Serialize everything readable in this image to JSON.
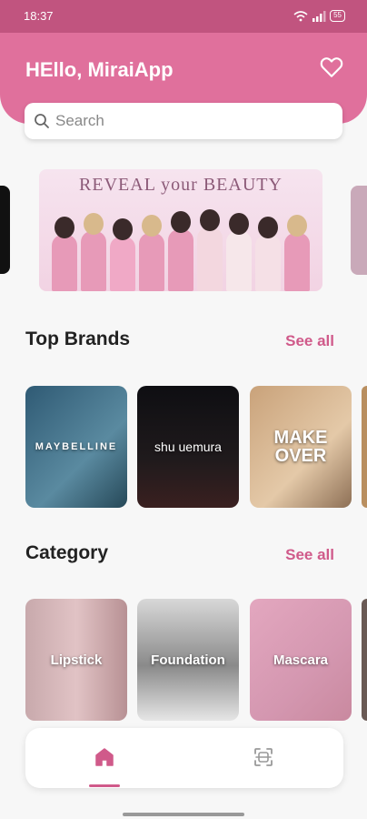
{
  "status_bar": {
    "time": "18:37",
    "battery": "55"
  },
  "header": {
    "greeting": "HEllo, MiraiApp"
  },
  "search": {
    "placeholder": "Search"
  },
  "banner": {
    "title": "REVEAL your BEAUTY"
  },
  "top_brands": {
    "title": "Top Brands",
    "see_all": "See all",
    "items": [
      {
        "label": "MAYBELLINE"
      },
      {
        "label": "shu uemura"
      },
      {
        "label": "MAKE OVER"
      }
    ]
  },
  "category": {
    "title": "Category",
    "see_all": "See all",
    "items": [
      {
        "label": "Lipstick"
      },
      {
        "label": "Foundation"
      },
      {
        "label": "Mascara"
      }
    ]
  },
  "colors": {
    "primary": "#e0709c",
    "status_bar": "#c1547f",
    "accent": "#d05a8a"
  },
  "icons": [
    "wifi-icon",
    "signal-icon",
    "battery-icon",
    "heart-icon",
    "search-icon",
    "home-icon",
    "scan-icon"
  ]
}
